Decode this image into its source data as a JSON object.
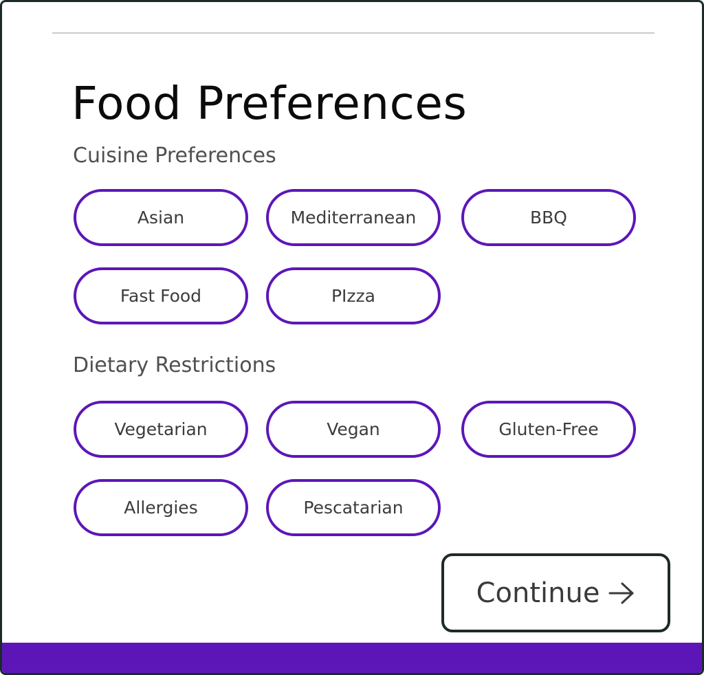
{
  "page": {
    "title": "Food Preferences",
    "accent_color": "#5c16b8",
    "border_color": "#1d2a2a"
  },
  "cuisine": {
    "heading": "Cuisine Preferences",
    "options": [
      "Asian",
      "Mediterranean",
      "BBQ",
      "Fast Food",
      "PIzza"
    ]
  },
  "dietary": {
    "heading": "Dietary Restrictions",
    "options": [
      "Vegetarian",
      "Vegan",
      "Gluten-Free",
      "Allergies",
      "Pescatarian"
    ]
  },
  "actions": {
    "continue_label": "Continue",
    "continue_icon": "arrow-right-icon"
  }
}
